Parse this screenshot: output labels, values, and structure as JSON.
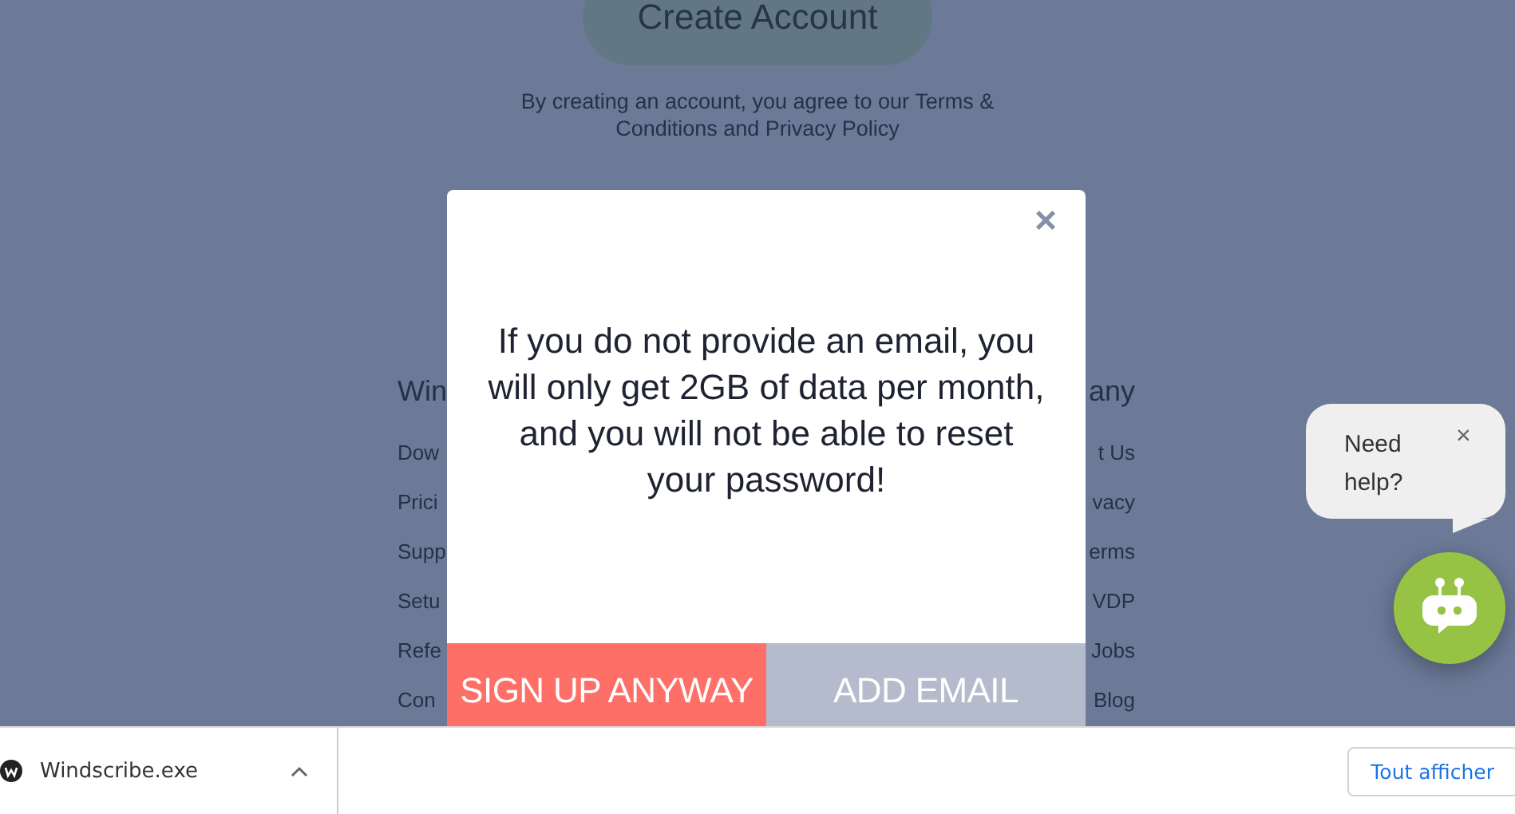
{
  "page": {
    "create_button": "Create Account",
    "terms": "By creating an account, you agree to our Terms & Conditions and Privacy Policy",
    "footer_left": {
      "heading": "Win",
      "links": [
        "Dow",
        "Prici",
        "Supp",
        "Setu",
        "Refe",
        "Con"
      ]
    },
    "footer_right": {
      "heading": "any",
      "links": [
        "t Us",
        "vacy",
        "erms",
        "VDP",
        "Jobs",
        "Blog"
      ]
    }
  },
  "modal": {
    "close": "×",
    "message": "If you do not provide an email, you will only get 2GB of data per month, and you will not be able to reset your password!",
    "buttons": [
      {
        "label": "SIGN UP ANYWAY",
        "kind": "primary"
      },
      {
        "label": "ADD EMAIL",
        "kind": "secondary"
      }
    ]
  },
  "chat": {
    "bubble": "Need help?",
    "close": "×"
  },
  "downloads": {
    "file": "Windscribe.exe",
    "show_all": "Tout afficher"
  }
}
